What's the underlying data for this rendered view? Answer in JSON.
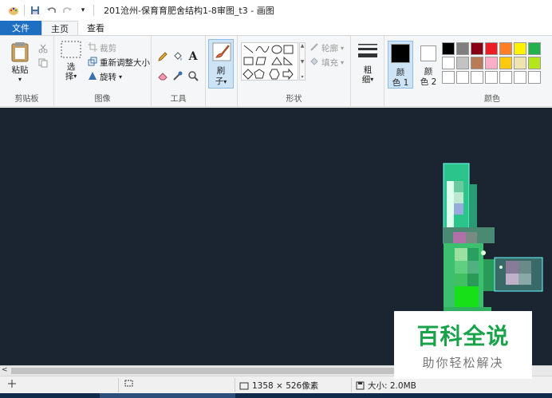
{
  "window": {
    "title": "201沧州-保育育肥舍结构1-8审图_t3 - 画图"
  },
  "tabs": [
    {
      "label": "文件"
    },
    {
      "label": "主页"
    },
    {
      "label": "查看"
    }
  ],
  "clipboard": {
    "paste_label": "粘贴",
    "group_label": "剪贴板"
  },
  "image": {
    "select_label_1": "选",
    "select_label_2": "择",
    "crop_label": "裁剪",
    "resize_label": "重新调整大小",
    "rotate_label": "旋转",
    "group_label": "图像"
  },
  "tools": {
    "text_glyph": "A",
    "group_label": "工具"
  },
  "brushes": {
    "label_1": "刷",
    "label_2": "子"
  },
  "shapes": {
    "outline_label": "轮廓",
    "fill_label": "填充",
    "group_label": "形状"
  },
  "size": {
    "label_1": "粗",
    "label_2": "细"
  },
  "colors": {
    "color1_label_1": "颜",
    "color1_label_2": "色 1",
    "color2_label_1": "颜",
    "color2_label_2": "色 2",
    "group_label": "颜色",
    "color1_value": "#000000",
    "color2_value": "#ffffff",
    "palette": [
      "#000000",
      "#7f7f7f",
      "#880015",
      "#ed1c24",
      "#ff7f27",
      "#fff200",
      "#22b14c",
      "#ffffff",
      "#c3c3c3",
      "#b97a57",
      "#ffaec9",
      "#ffc90e",
      "#efe4b0",
      "#b5e61d",
      "#ffffff",
      "#ffffff",
      "#ffffff",
      "#ffffff",
      "#ffffff",
      "#ffffff",
      "#ffffff"
    ]
  },
  "statusbar": {
    "dimensions": "1358 × 526像素",
    "size": "大小: 2.0MB"
  },
  "watermark": {
    "main": "百科全说",
    "sub": "助你轻松解决"
  }
}
